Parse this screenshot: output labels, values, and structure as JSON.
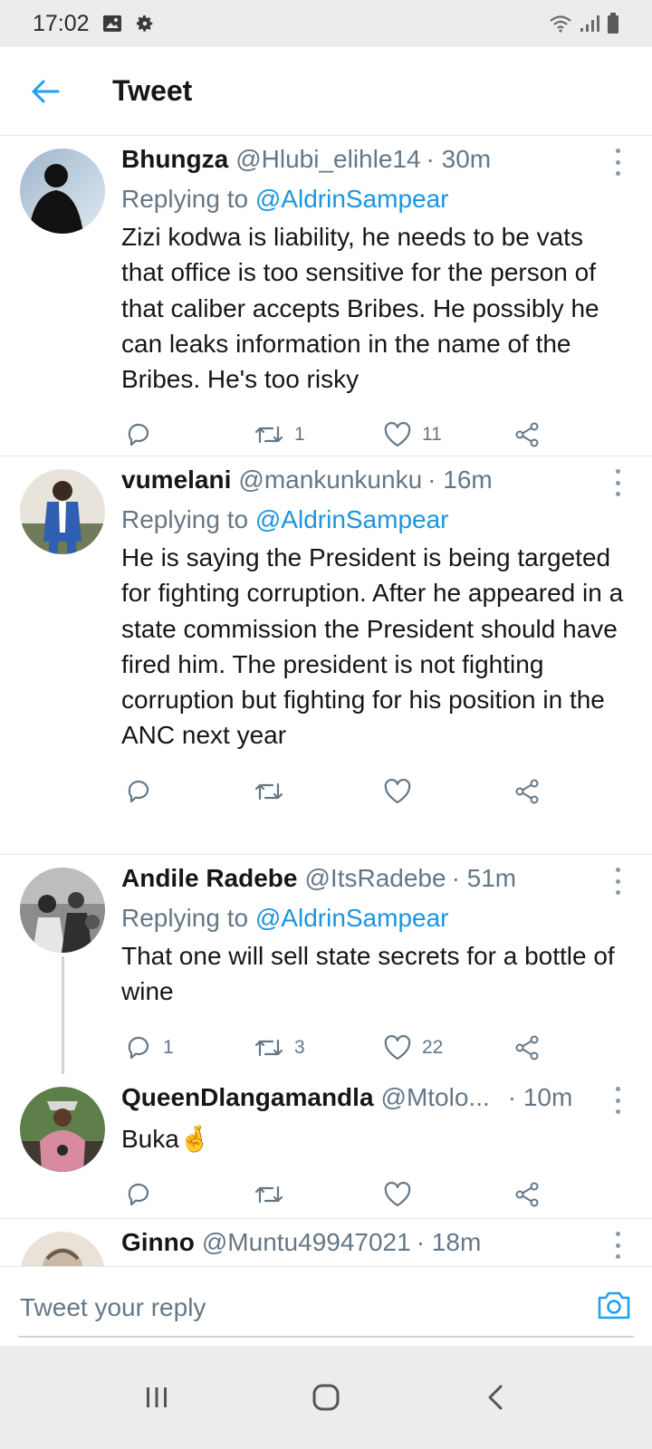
{
  "status_bar": {
    "time": "17:02",
    "left_icons": [
      "image-icon",
      "gear-icon"
    ],
    "right_icons": [
      "wifi-icon",
      "signal-icon",
      "battery-icon"
    ]
  },
  "header": {
    "title": "Tweet",
    "back_icon": "arrow-left-icon",
    "accent_color": "#1da1f2"
  },
  "tweets": [
    {
      "name": "Bhungza",
      "handle": "@Hlubi_elihle14",
      "time": "· 30m",
      "replying_prefix": "Replying to",
      "replying_to": "@AldrinSampear",
      "text": "Zizi kodwa is liability, he needs to be vats that office is too sensitive for the person of that caliber accepts Bribes. He possibly he can leaks information in the name of the Bribes. He's too risky",
      "retweets": "1",
      "likes": "11"
    },
    {
      "name": "vumelani",
      "handle": "@mankunkunku",
      "time": "· 16m",
      "replying_prefix": "Replying to",
      "replying_to": "@AldrinSampear",
      "text": "He is saying the President is being targeted for fighting corruption. After he appeared in a state commission the President should have fired him. The president is not fighting corruption but fighting for his position in the ANC next year"
    },
    {
      "name": "Andile Radebe",
      "handle": "@ItsRadebe",
      "time": "· 51m",
      "replying_prefix": "Replying to",
      "replying_to": "@AldrinSampear",
      "text": "That one will sell state secrets for a bottle of wine",
      "replies": "1",
      "retweets": "3",
      "likes": "22"
    },
    {
      "name": "QueenDlangamandla",
      "handle": "@Mtolo...",
      "time": "· 10m",
      "text": "Buka",
      "emoji": "🤞"
    },
    {
      "name": "Ginno",
      "handle": "@Muntu49947021",
      "time": "· 18m"
    }
  ],
  "reply_bar": {
    "placeholder": "Tweet your reply",
    "camera_icon": "camera-icon"
  },
  "nav_bar": {
    "icons": [
      "recent-apps-icon",
      "home-icon",
      "back-icon"
    ]
  }
}
